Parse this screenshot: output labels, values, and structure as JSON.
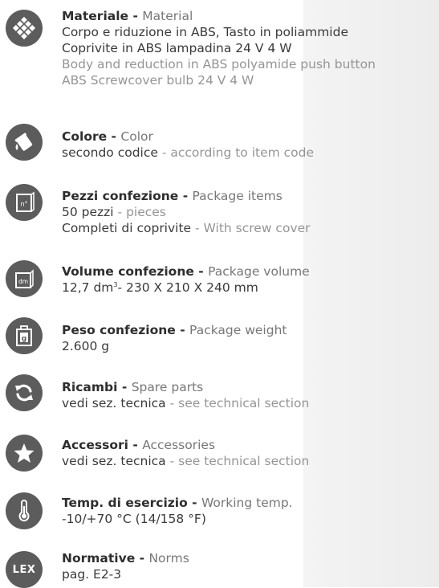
{
  "material": {
    "title_it": "Materiale",
    "title_en": "Material",
    "line1": "Corpo e riduzione in ABS, Tasto in poliammide",
    "line2": "Coprivite in ABS lampadina 24 V 4 W",
    "line3": "Body and reduction in ABS polyamide push button",
    "line4": "ABS Screwcover bulb 24 V 4 W"
  },
  "color": {
    "title_it": "Colore",
    "title_en": "Color",
    "value_it": "secondo codice",
    "value_en": "according to item code"
  },
  "package_items": {
    "title_it": "Pezzi confezione",
    "title_en": "Package items",
    "icon_text": "n°",
    "qty_it": "50 pezzi",
    "qty_en": "pieces",
    "extra_it": "Completi di coprivite",
    "extra_en": "With screw cover"
  },
  "package_volume": {
    "title_it": "Volume confezione",
    "title_en": "Package volume",
    "icon_text": "dm",
    "volume": "12,7 dm",
    "volume_sup": "3",
    "dimensions": "- 230 X 210 X 240 mm"
  },
  "package_weight": {
    "title_it": "Peso confezione",
    "title_en": "Package weight",
    "icon_text": "g",
    "value": "2.600 g"
  },
  "spare_parts": {
    "title_it": "Ricambi",
    "title_en": "Spare parts",
    "value_it": "vedi sez. tecnica",
    "value_en": "see technical section"
  },
  "accessories": {
    "title_it": "Accessori",
    "title_en": "Accessories",
    "value_it": "vedi sez. tecnica",
    "value_en": "see technical section"
  },
  "working_temp": {
    "title_it": "Temp. di esercizio",
    "title_en": "Working temp.",
    "value": "-10/+70 °C (14/158 °F)"
  },
  "norms": {
    "title_it": "Normative",
    "title_en": "Norms",
    "icon_text": "LEX",
    "value": "pag. E2-3"
  },
  "separator": " - ",
  "colors": {
    "icon_bg": "#5c5c5c",
    "title_en": "#777777",
    "secondary": "#959595",
    "shade": "#ececec"
  }
}
